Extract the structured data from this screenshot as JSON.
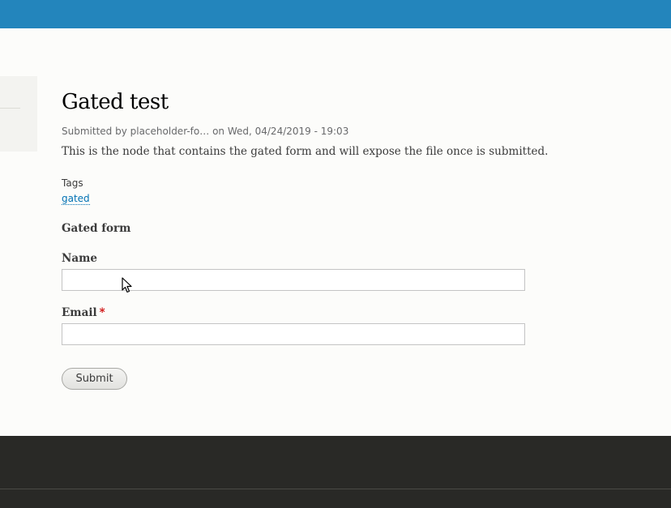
{
  "node": {
    "title": "Gated test",
    "submitted": "Submitted by placeholder-fo… on Wed, 04/24/2019 - 19:03",
    "body": "This is the node that contains the gated form and will expose the file once is submitted.",
    "tags_label": "Tags",
    "tags": [
      "gated"
    ]
  },
  "form": {
    "heading": "Gated form",
    "name_label": "Name",
    "name_value": "",
    "email_label": "Email",
    "email_required_marker": "*",
    "email_value": "",
    "submit_label": "Submit"
  },
  "colors": {
    "topbar": "#2385bc",
    "link": "#0071b3",
    "footer": "#292926",
    "required": "#cc0000"
  }
}
